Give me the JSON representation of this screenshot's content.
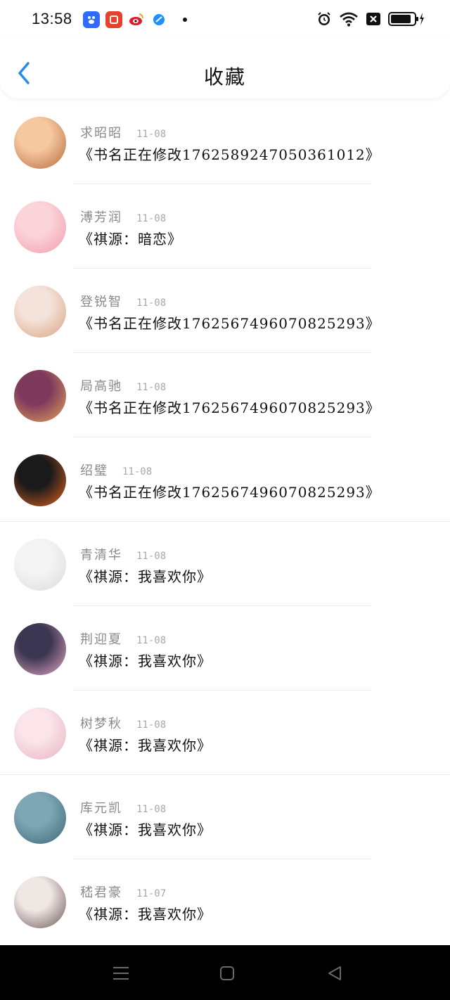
{
  "status_bar": {
    "time": "13:58",
    "apps": [
      {
        "name": "baidu-app-icon",
        "glyph": "•",
        "color": "#2f6bff"
      },
      {
        "name": "pinduoduo-app-icon",
        "glyph": "□",
        "color": "#e8412d"
      },
      {
        "name": "weibo-app-icon",
        "glyph": "●",
        "color": "#e6162d"
      },
      {
        "name": "browser-app-icon",
        "glyph": "◆",
        "color": "#1e90ff"
      }
    ],
    "battery_percent": 85
  },
  "header": {
    "title": "收藏",
    "back_icon": "chevron-left-icon"
  },
  "favorites": [
    {
      "author": "求昭昭",
      "date": "11-08",
      "book": "《书名正在修改1762589247050361012》",
      "avatar_colors": [
        "#f6c89f",
        "#b56a3d"
      ],
      "divider": "inset"
    },
    {
      "author": "溥芳润",
      "date": "11-08",
      "book": "《祺源：暗恋》",
      "avatar_colors": [
        "#fbd4da",
        "#f29bab"
      ],
      "divider": "inset"
    },
    {
      "author": "登锐智",
      "date": "11-08",
      "book": "《书名正在修改1762567496070825293》",
      "avatar_colors": [
        "#f4e3da",
        "#d9a27e"
      ],
      "divider": "inset"
    },
    {
      "author": "局高驰",
      "date": "11-08",
      "book": "《书名正在修改1762567496070825293》",
      "avatar_colors": [
        "#7d3a5c",
        "#e8a35a"
      ],
      "divider": "inset"
    },
    {
      "author": "绍璧",
      "date": "11-08",
      "book": "《书名正在修改1762567496070825293》",
      "avatar_colors": [
        "#1a1a1a",
        "#e0631f"
      ],
      "divider": "full"
    },
    {
      "author": "青清华",
      "date": "11-08",
      "book": "《祺源：我喜欢你》",
      "avatar_colors": [
        "#f4f4f4",
        "#dcdcdc"
      ],
      "divider": "inset"
    },
    {
      "author": "荆迎夏",
      "date": "11-08",
      "book": "《祺源：我喜欢你》",
      "avatar_colors": [
        "#3a3550",
        "#e6a7c6"
      ],
      "divider": "inset"
    },
    {
      "author": "树梦秋",
      "date": "11-08",
      "book": "《祺源：我喜欢你》",
      "avatar_colors": [
        "#fbe4ea",
        "#e7b2bf"
      ],
      "divider": "full"
    },
    {
      "author": "库元凯",
      "date": "11-08",
      "book": "《祺源：我喜欢你》",
      "avatar_colors": [
        "#7ea7b5",
        "#3d6677"
      ],
      "divider": "inset"
    },
    {
      "author": "嵇君豪",
      "date": "11-07",
      "book": "《祺源：我喜欢你》",
      "avatar_colors": [
        "#efe7e4",
        "#6b5555"
      ],
      "divider": "none"
    }
  ],
  "navigation": {
    "menu_icon": "menu-icon",
    "home_icon": "home-square-icon",
    "back_icon": "back-triangle-icon"
  },
  "colors": {
    "accent": "#2a8ae8",
    "text_primary": "#111111",
    "text_secondary": "#8a8a8a"
  }
}
